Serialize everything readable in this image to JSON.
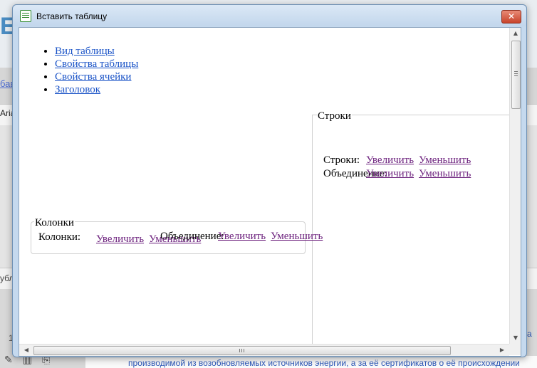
{
  "background": {
    "logo_letter": "E",
    "link_fragment": "бав",
    "font_fragment": "Arial",
    "pub_fragment": "убл",
    "line_number": "1",
    "right_fragment": "а",
    "bottom_text": "производимой из возобновляемых источников энергии, а за её сертификатов о её происхождении"
  },
  "dialog": {
    "title": "Вставить таблицу",
    "close_symbol": "✕"
  },
  "tabs": [
    {
      "label": "Вид таблицы"
    },
    {
      "label": "Свойства таблицы"
    },
    {
      "label": "Свойства ячейки"
    },
    {
      "label": "Заголовок"
    }
  ],
  "rows_section": {
    "legend": "Строки",
    "rows_label": "Строки:",
    "merge_label": "Объединение:",
    "increase": "Увеличить",
    "decrease": "Уменьшить"
  },
  "columns_section": {
    "legend": "Колонки",
    "cols_label": "Колонки:",
    "merge_label": "Объединение:",
    "increase": "Увеличить",
    "decrease": "Уменьшить"
  },
  "scrollbars": {
    "up_arrow": "▲",
    "down_arrow": "▼",
    "left_arrow": "◀",
    "right_arrow": "▶"
  }
}
